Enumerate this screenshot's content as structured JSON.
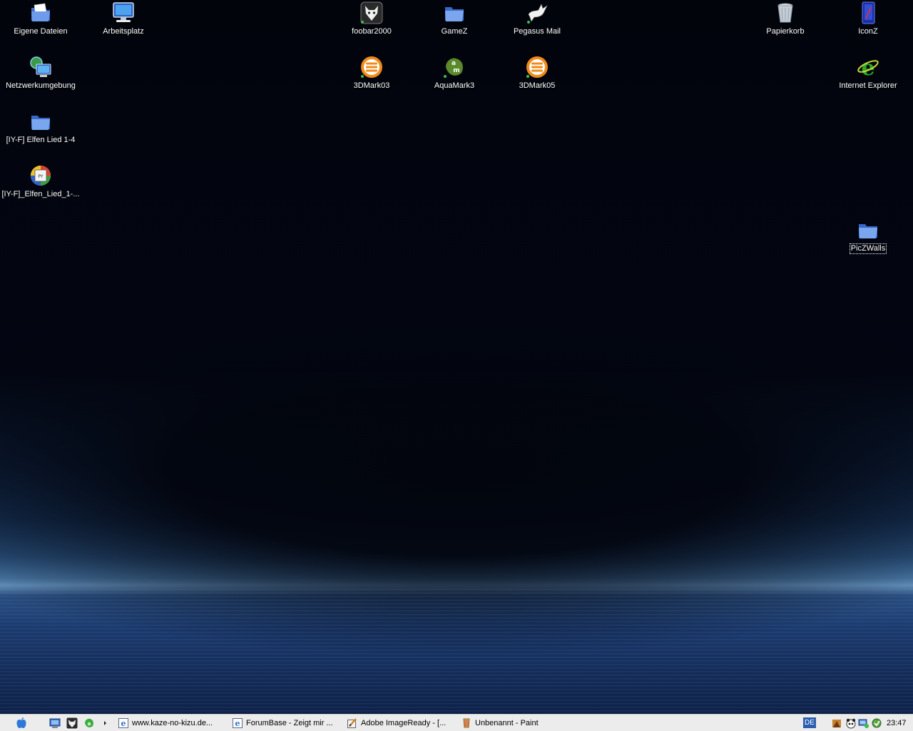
{
  "desktop": {
    "icons": [
      {
        "id": "eigene",
        "label": "Eigene Dateien",
        "icon": "my-documents-icon"
      },
      {
        "id": "arbeitsplatz",
        "label": "Arbeitsplatz",
        "icon": "my-computer-icon"
      },
      {
        "id": "netzwerk",
        "label": "Netzwerkumgebung",
        "icon": "network-places-icon"
      },
      {
        "id": "elfen-folder",
        "label": "[IY-F] Elfen Lied 1-4",
        "icon": "folder-icon"
      },
      {
        "id": "elfen-file",
        "label": "[IY-F]_Elfen_Lied_1-...",
        "icon": "media-file-icon"
      },
      {
        "id": "foobar",
        "label": "foobar2000",
        "icon": "foobar-icon"
      },
      {
        "id": "gamez",
        "label": "GameZ",
        "icon": "folder-icon"
      },
      {
        "id": "pegasus",
        "label": "Pegasus Mail",
        "icon": "pegasus-icon"
      },
      {
        "id": "3dmark03",
        "label": "3DMark03",
        "icon": "3dmark-icon"
      },
      {
        "id": "aquamark",
        "label": "AquaMark3",
        "icon": "aquamark-icon"
      },
      {
        "id": "3dmark05",
        "label": "3DMark05",
        "icon": "3dmark-icon"
      },
      {
        "id": "papierkorb",
        "label": "Papierkorb",
        "icon": "recycle-bin-icon"
      },
      {
        "id": "iconz",
        "label": "IconZ",
        "icon": "iconz-icon"
      },
      {
        "id": "ie",
        "label": "Internet Explorer",
        "icon": "internet-explorer-icon"
      },
      {
        "id": "piczwalls",
        "label": "PicZWalls",
        "icon": "folder-icon",
        "selected": true
      }
    ]
  },
  "taskbar": {
    "quicklaunch": [
      "start-apple-icon",
      "show-desktop-icon",
      "foobar-icon",
      "aquamark-icon",
      "chevron-right-icon"
    ],
    "tasks": [
      {
        "label": "www.kaze-no-kizu.de...",
        "icon": "internet-explorer-icon"
      },
      {
        "label": "ForumBase - Zeigt mir ...",
        "icon": "internet-explorer-icon"
      },
      {
        "label": "Adobe ImageReady - [...",
        "icon": "imageready-icon"
      },
      {
        "label": "Unbenannt - Paint",
        "icon": "paint-icon"
      }
    ],
    "language": "DE",
    "clock": "23:47"
  },
  "colors": {
    "accent": "#2a5fb0",
    "taskbar": "#ececec",
    "label": "#ffffff"
  }
}
